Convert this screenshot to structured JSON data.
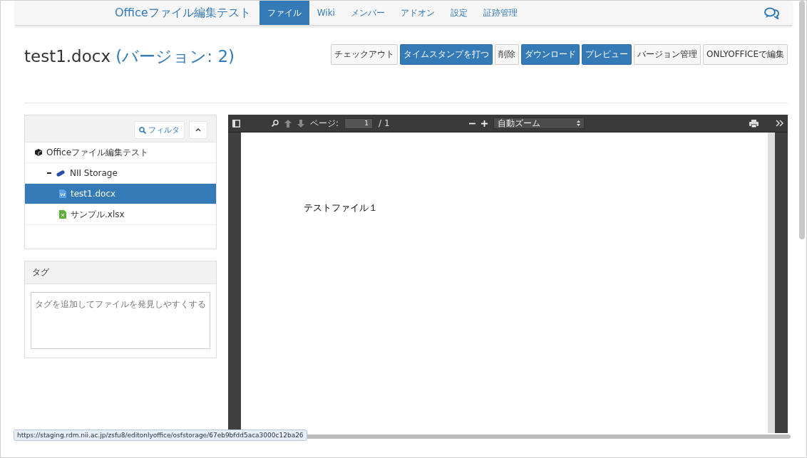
{
  "navbar": {
    "brand": "Officeファイル編集テスト",
    "tabs": [
      {
        "label": "ファイル",
        "selected": true
      },
      {
        "label": "Wiki",
        "selected": false
      },
      {
        "label": "メンバー",
        "selected": false
      },
      {
        "label": "アドオン",
        "selected": false
      },
      {
        "label": "設定",
        "selected": false
      },
      {
        "label": "証跡管理",
        "selected": false
      }
    ]
  },
  "file_title": {
    "name": "test1.docx",
    "version": "(バージョン: 2)"
  },
  "actions": [
    {
      "label": "チェックアウト",
      "kind": "default"
    },
    {
      "label": "タイムスタンプを打つ",
      "kind": "primary"
    },
    {
      "label": "削除",
      "kind": "default"
    },
    {
      "label": "ダウンロード",
      "kind": "primary"
    },
    {
      "label": "プレビュー",
      "kind": "primary"
    },
    {
      "label": "バージョン管理",
      "kind": "default"
    },
    {
      "label": "ONLYOFFICEで編集",
      "kind": "default"
    }
  ],
  "file_tree": {
    "filter_button": "フィルタ",
    "items": [
      {
        "label": "Officeファイル編集テスト",
        "kind": "project",
        "selected": false,
        "children": [
          {
            "label": "NII Storage",
            "kind": "storage",
            "expanded": true,
            "selected": false,
            "children": [
              {
                "label": "test1.docx",
                "kind": "docx",
                "selected": true
              },
              {
                "label": "サンプル.xlsx",
                "kind": "xlsx",
                "selected": false
              }
            ]
          }
        ]
      }
    ]
  },
  "tags": {
    "title": "タグ",
    "placeholder": "タグを追加してファイルを発見しやすくする"
  },
  "viewer": {
    "page_label": "ページ:",
    "page_value": "1",
    "page_total": "/ 1",
    "zoom": "自動ズーム",
    "document_text": "テストファイル１"
  },
  "status_url": "https://staging.rdm.nii.ac.jp/zsfu8/editonlyoffice/osfstorage/67eb9bfdd5aca3000c12ba26"
}
